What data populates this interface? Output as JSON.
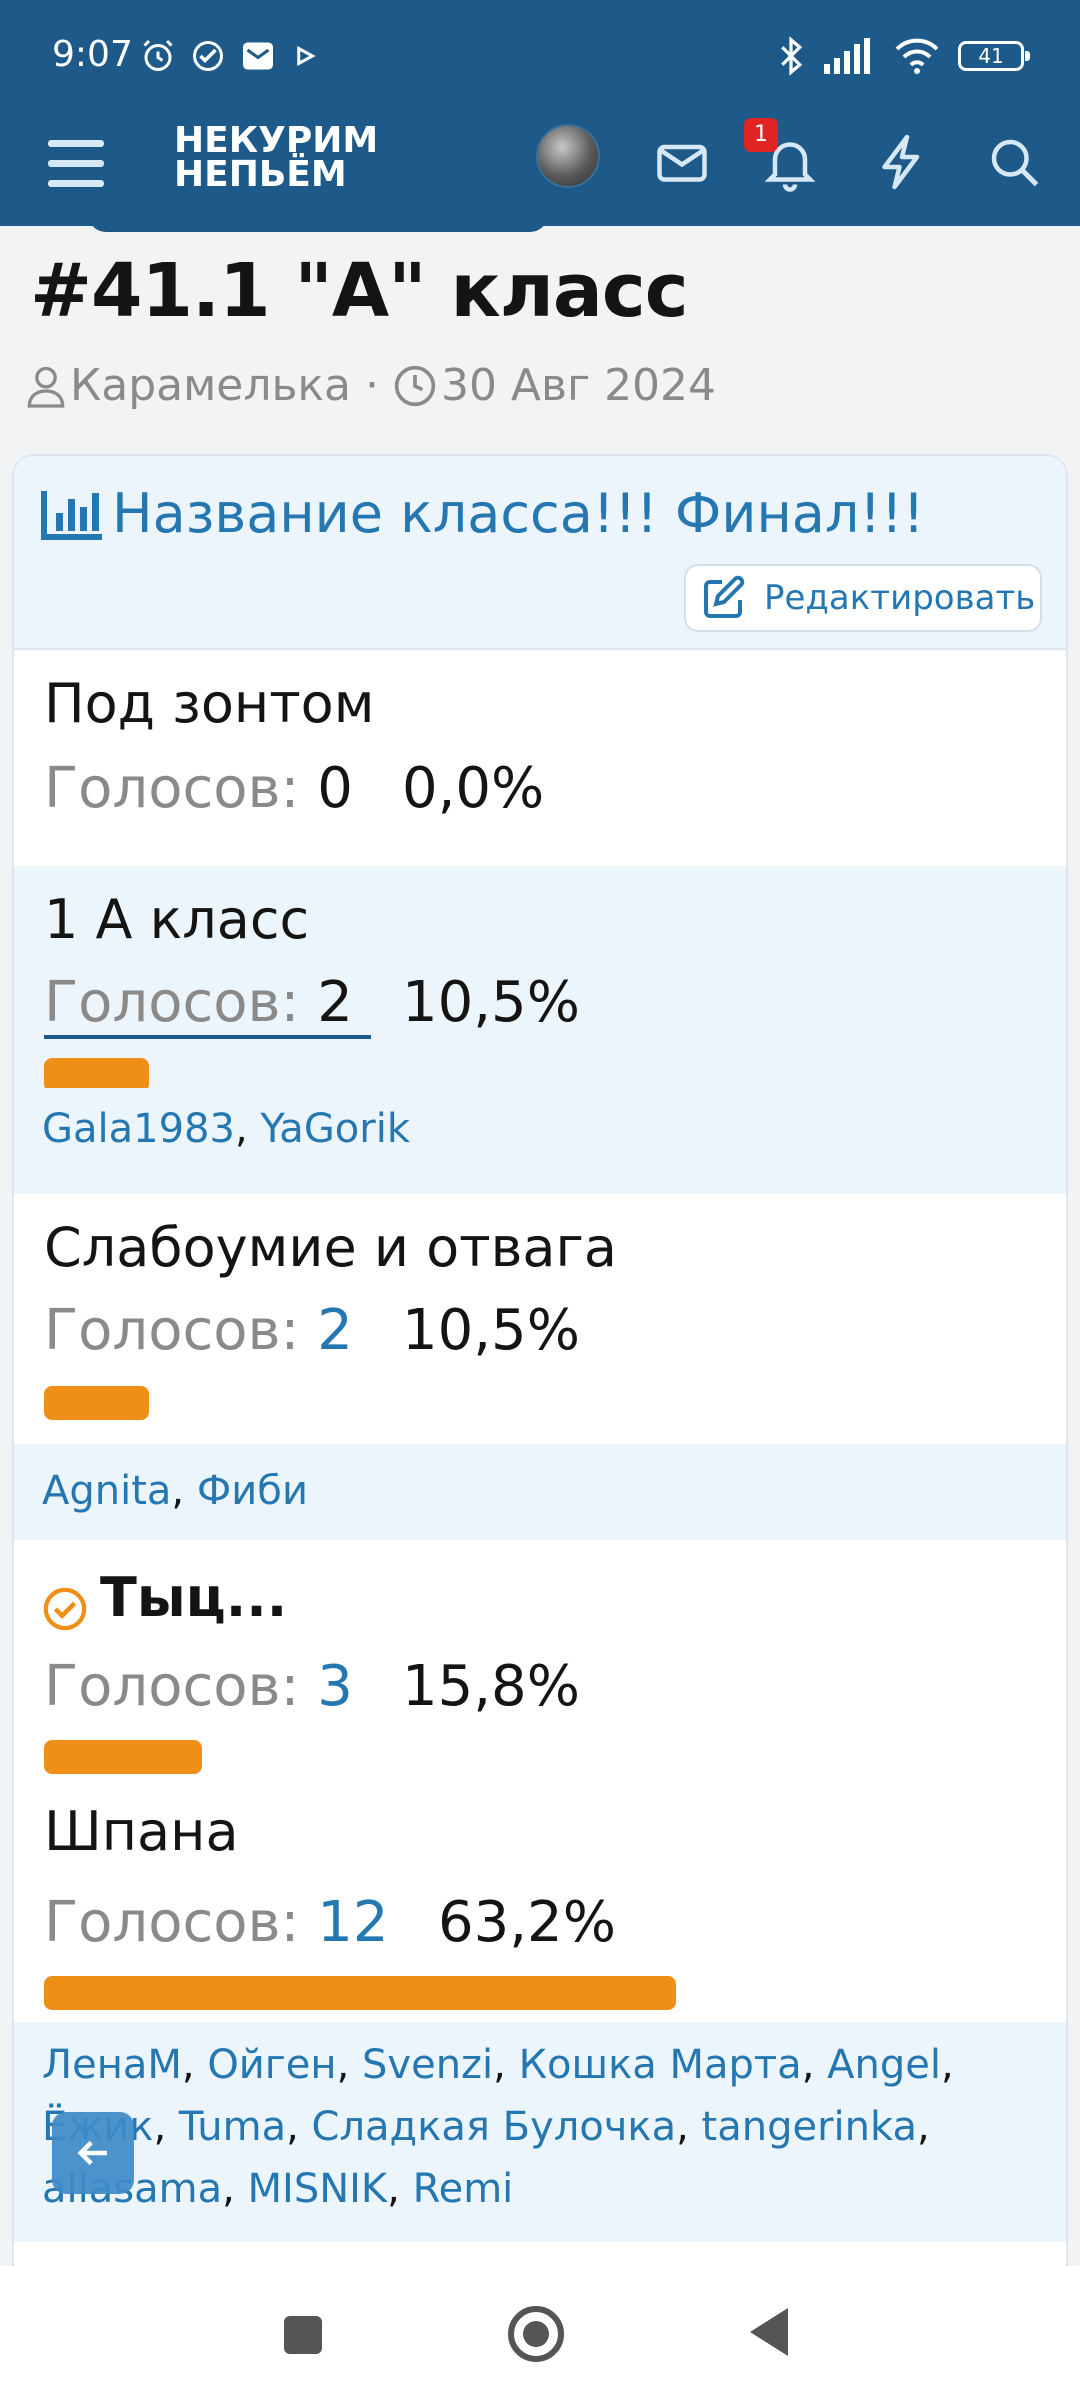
{
  "status_bar": {
    "time": "9:07",
    "battery": "41",
    "icons": [
      "alarm-icon",
      "check-circle-icon",
      "mail-icon",
      "play-icon",
      "bluetooth-icon",
      "signal-icon",
      "wifi-icon",
      "battery-icon"
    ]
  },
  "header": {
    "logo_line1": "НЕКУРИМ",
    "logo_line2": "НЕПЬЁМ",
    "notification_count": "1",
    "icons": [
      "menu-icon",
      "avatar",
      "mail-icon",
      "bell-icon",
      "lightning-icon",
      "search-icon"
    ]
  },
  "thread": {
    "title": "#41.1 \"А\" класс",
    "author": "Карамелька",
    "separator": "·",
    "date": "30 Авг 2024"
  },
  "poll": {
    "title": "Название класса!!! Финал!!!",
    "edit_label": "Редактировать",
    "votes_label": "Голосов:",
    "accent_color": "#ef8f17",
    "link_color": "#2577b1",
    "options": [
      {
        "name": "Под зонтом",
        "votes": "0",
        "percent": "0,0%",
        "fraction": 0.0,
        "voters": []
      },
      {
        "name": "1 А класс",
        "votes": "2",
        "percent": "10,5%",
        "fraction": 0.105,
        "voters": [
          "Gala1983",
          "YaGorik"
        ]
      },
      {
        "name": "Слабоумие и отвага",
        "votes": "2",
        "percent": "10,5%",
        "fraction": 0.105,
        "voters": [
          "Agnita",
          "Фиби"
        ]
      },
      {
        "name": "Тыц...",
        "votes": "3",
        "percent": "15,8%",
        "fraction": 0.158,
        "selected": true,
        "voters": []
      },
      {
        "name": "Шпана",
        "votes": "12",
        "percent": "63,2%",
        "fraction": 0.632,
        "voters": [
          "ЛенаМ",
          "Ойген",
          "Svenzi",
          "Кошка Марта",
          "Angel",
          "Ёжик",
          "Tuma",
          "Сладкая Булочка",
          "tangerinka",
          "allasama",
          "MISNIK",
          "Remi"
        ]
      }
    ]
  }
}
